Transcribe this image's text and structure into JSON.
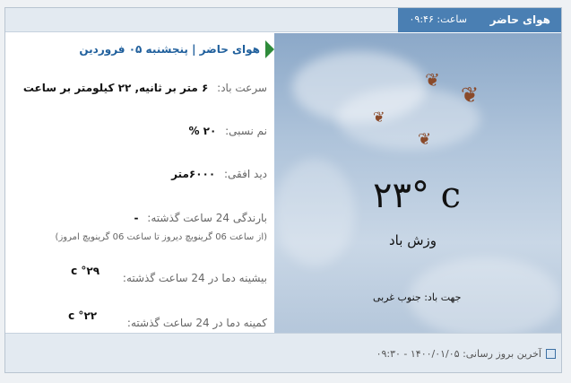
{
  "header": {
    "title": "هوای حاضر",
    "time_label": "ساعت:",
    "time_value": "۰۹:۴۶"
  },
  "weather": {
    "temperature": "۲۳° c",
    "condition": "وزش باد",
    "wind_direction_label": "جهت باد:",
    "wind_direction_value": "جنوب غربی"
  },
  "info": {
    "heading_title": "هوای حاضر",
    "heading_separator": "|",
    "heading_date": "پنجشنبه ۰۵ فروردین",
    "wind_speed_label": "سرعت باد:",
    "wind_speed_value": "۶ متر بر ثانیه, ۲۲ کیلومتر بر ساعت",
    "humidity_label": "نم نسبی:",
    "humidity_value": "۲۰ %",
    "visibility_label": "دید افقی:",
    "visibility_value": "۶۰۰۰متر",
    "rain_label": "بارندگی 24 ساعت گذشته:",
    "rain_value": "-",
    "rain_note": "(از ساعت 06 گرینویچ دیروز تا ساعت 06 گرینویچ امروز)",
    "max_temp_label": "بیشینه دما در 24 ساعت گذشته:",
    "max_temp_value": "۲۹° c",
    "min_temp_label": "کمینه دما در 24 ساعت گذشته:",
    "min_temp_value": "۲۲° c"
  },
  "footer": {
    "last_update_label": "آخرین بروز رسانی:",
    "last_update_value": "۱۴۰۰/۰۱/۰۵ - ۰۹:۳۰"
  },
  "icons": [
    "leaf-icon",
    "green-arrow-icon",
    "update-icon"
  ],
  "colors": {
    "tab": "#4a7fb3",
    "heading": "#1f5f9c",
    "arrow": "#2e8b3a"
  }
}
